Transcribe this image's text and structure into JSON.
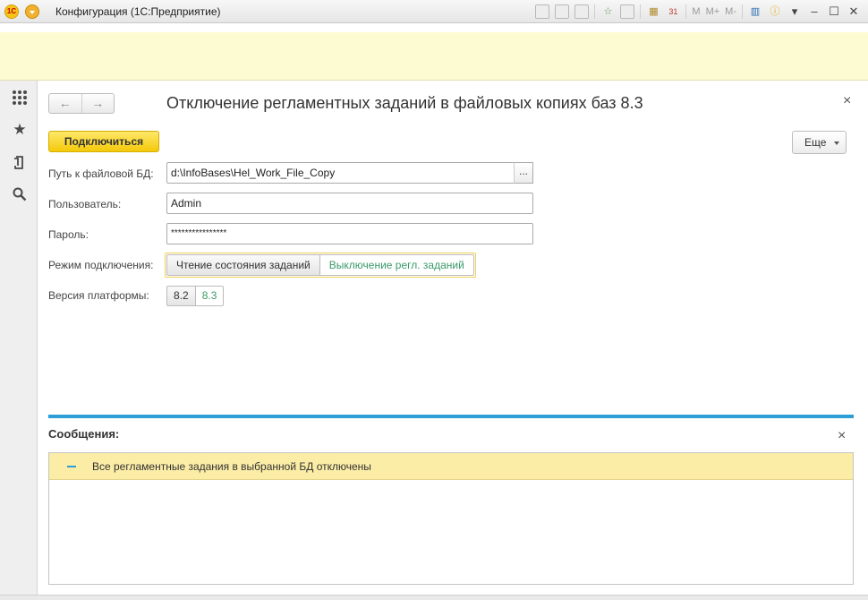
{
  "window": {
    "title": "Конфигурация (1С:Предприятие)"
  },
  "toolbar": {
    "m": "M",
    "m_plus": "M+",
    "m_minus": "M-"
  },
  "form": {
    "title": "Отключение регламентных заданий в файловых копиях баз 8.3",
    "connect_button": "Подключиться",
    "more_button": "Еще",
    "path_label": "Путь к файловой БД:",
    "path_value": "d:\\InfoBases\\Hel_Work_File_Copy",
    "path_select_button": "...",
    "user_label": "Пользователь:",
    "user_value": "Admin",
    "password_label": "Пароль:",
    "password_value": "****************",
    "mode_label": "Режим подключения:",
    "mode_options": [
      "Чтение состояния заданий",
      "Выключение регл. заданий"
    ],
    "mode_selected": "Чтение состояния заданий",
    "version_label": "Версия платформы:",
    "version_options": [
      "8.2",
      "8.3"
    ],
    "version_selected": "8.2"
  },
  "messages": {
    "title": "Сообщения:",
    "items": [
      "Все регламентные задания в выбранной БД отключены"
    ]
  },
  "colors": {
    "accent": "#2d9fd6",
    "primary_button": "#f4c90a",
    "banner": "#fdfbd2",
    "message_highlight": "#fbeca6",
    "option_inactive_text": "#3a9a6a"
  },
  "icons": {
    "left_panel": [
      "apps-grid-icon",
      "favorites-star-icon",
      "history-icon",
      "search-icon"
    ],
    "titlebar": [
      "save-icon",
      "print-icon",
      "preview-icon",
      "add-favorite-icon",
      "links-icon",
      "calculator-icon",
      "calendar-icon",
      "panel-icon",
      "info-icon",
      "minimize-icon",
      "maximize-icon",
      "close-icon"
    ]
  }
}
